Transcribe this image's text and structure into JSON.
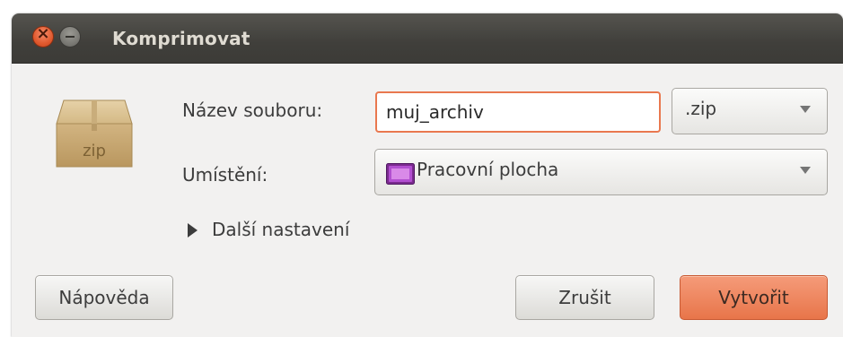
{
  "window": {
    "title": "Komprimovat"
  },
  "icons": {
    "archive": "zip-archive-icon",
    "archive_label": "zip",
    "folder": "desktop-folder-icon"
  },
  "form": {
    "filename_label": "Název souboru:",
    "filename_value": "muj_archiv",
    "extension_value": ".zip",
    "location_label": "Umístění:",
    "location_value": "Pracovní plocha",
    "more_options_label": "Další nastavení"
  },
  "buttons": {
    "help": "Nápověda",
    "cancel": "Zrušit",
    "create": "Vytvořit"
  },
  "colors": {
    "accent": "#e9784f",
    "titlebar": "#3c3b37",
    "background": "#f2f1f0"
  }
}
